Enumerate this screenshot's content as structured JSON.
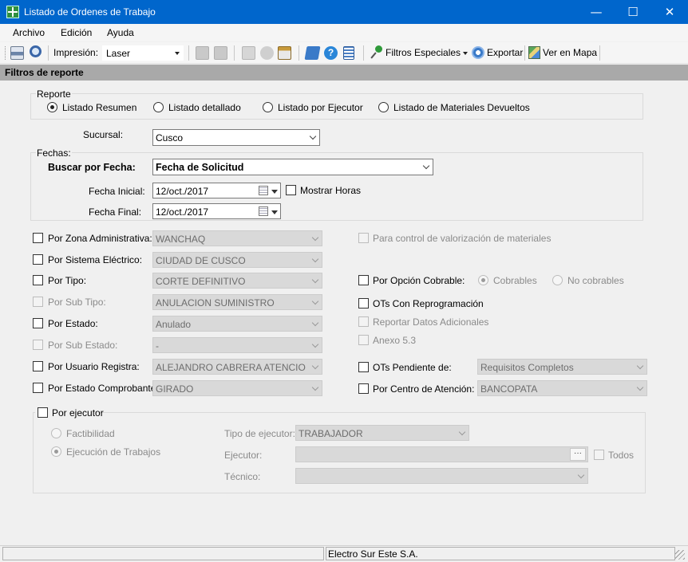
{
  "window": {
    "title": "Listado de Ordenes de Trabajo",
    "minimize": "—",
    "maximize": "☐",
    "close": "✕"
  },
  "menu": [
    "Archivo",
    "Edición",
    "Ayuda"
  ],
  "toolbar": {
    "impresion_label": "Impresión:",
    "printer_value": "Laser",
    "filtros_especiales": "Filtros Especiales",
    "exportar": "Exportar",
    "ver_en_mapa": "Ver en Mapa"
  },
  "section_title": "Filtros de reporte",
  "reporte": {
    "legend": "Reporte",
    "options": [
      "Listado Resumen",
      "Listado detallado",
      "Listado por Ejecutor",
      "Listado de Materiales Devueltos"
    ],
    "selected": "Listado Resumen"
  },
  "sucursal": {
    "label": "Sucursal:",
    "value": "Cusco"
  },
  "fechas": {
    "legend": "Fechas:",
    "buscar_label": "Buscar por Fecha:",
    "buscar_value": "Fecha de Solicitud",
    "inicial_label": "Fecha Inicial:",
    "inicial_value": "12/oct./2017",
    "final_label": "Fecha Final:",
    "final_value": "12/oct./2017",
    "mostrar_horas": "Mostrar Horas"
  },
  "filters_left": [
    {
      "label": "Por Zona Administrativa:",
      "value": "WANCHAQ",
      "enabled": true
    },
    {
      "label": "Por Sistema Eléctrico:",
      "value": "CIUDAD DE CUSCO",
      "enabled": true
    },
    {
      "label": "Por Tipo:",
      "value": "CORTE DEFINITIVO",
      "enabled": true
    },
    {
      "label": "Por Sub Tipo:",
      "value": "ANULACION SUMINISTRO",
      "enabled": false
    },
    {
      "label": "Por Estado:",
      "value": "Anulado",
      "enabled": true
    },
    {
      "label": "Por Sub Estado:",
      "value": "-",
      "enabled": false
    },
    {
      "label": "Por Usuario Registra:",
      "value": "ALEJANDRO CABRERA ATENCIO",
      "enabled": true
    },
    {
      "label": "Por Estado Comprobante:",
      "value": "GIRADO",
      "enabled": true
    }
  ],
  "filters_right": {
    "control_valorizacion": "Para control de valorización de materiales",
    "opcion_cobrable": "Por Opción Cobrable:",
    "cobrables": "Cobrables",
    "no_cobrables": "No cobrables",
    "reprogramacion": "OTs Con Reprogramación",
    "datos_adicionales": "Reportar Datos Adicionales",
    "anexo": "Anexo 5.3",
    "pendiente_label": "OTs Pendiente de:",
    "pendiente_value": "Requisitos Completos",
    "centro_label": "Por Centro de Atención:",
    "centro_value": "BANCOPATA"
  },
  "ejecutor": {
    "legend": "Por ejecutor",
    "factibilidad": "Factibilidad",
    "ejecucion": "Ejecución de Trabajos",
    "tipo_label": "Tipo de ejecutor:",
    "tipo_value": "TRABAJADOR",
    "ejecutor_label": "Ejecutor:",
    "ejecutor_btn": "···",
    "todos": "Todos",
    "tecnico_label": "Técnico:"
  },
  "status": {
    "company": "Electro Sur Este S.A."
  },
  "colors": {
    "titlebar": "#0066cc",
    "section_bar": "#a9a9a9",
    "background": "#f0f0f0"
  },
  "icons": [
    "print-icon",
    "print-preview-icon",
    "toolbar-disabled-icons",
    "help-icon",
    "calculator-icon",
    "pin-icon",
    "gear-icon",
    "map-icon",
    "app-icon",
    "calendar-icon"
  ]
}
